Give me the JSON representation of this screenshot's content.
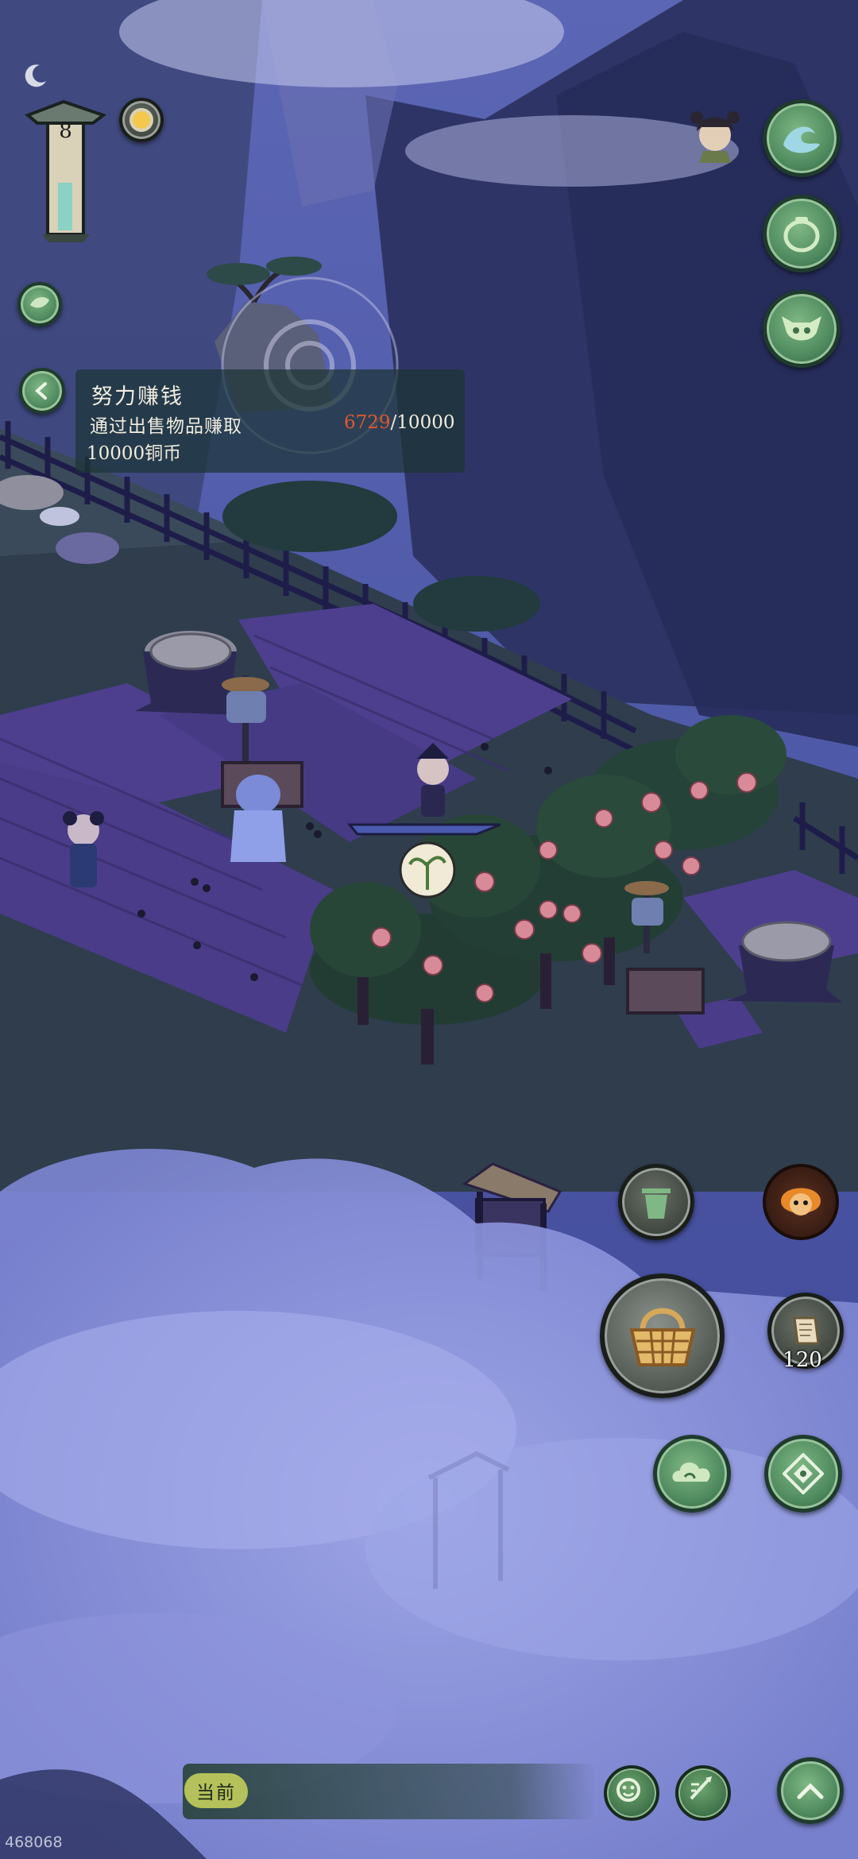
{
  "hud": {
    "level": "8",
    "moon_icon": "crescent-moon-icon",
    "sun_icon": "sun-orb-icon",
    "leaf_icon": "leaf-icon",
    "back_icon": "back-arrow-icon"
  },
  "task": {
    "title": "努力赚钱",
    "description_line1": "通过出售物品赚取",
    "description_line2": "10000铜币",
    "progress_current": "6729",
    "progress_separator": "/",
    "progress_total": "10000"
  },
  "right_menu": {
    "portrait_icon": "character-portrait-icon",
    "wave_icon": "wave-icon",
    "jar_icon": "jar-icon",
    "mask_icon": "demon-mask-icon"
  },
  "actions": {
    "trash_icon": "trash-can-icon",
    "monkey_icon": "fire-monkey-icon",
    "basket_icon": "basket-icon",
    "scroll_icon": "scroll-icon",
    "scroll_count": "120",
    "cloud_icon": "cloud-icon",
    "compass_icon": "compass-icon"
  },
  "bottom": {
    "current_label": "当前",
    "emote_icon": "emote-face-icon",
    "chat_icon": "chat-quill-icon",
    "expand_icon": "chevron-up-icon"
  },
  "watermark": "468068",
  "colors": {
    "sky": "#4b56a6",
    "mist": "#8f98dd",
    "field": "#4a3f86",
    "grass": "#2f3f4a",
    "button_green": "#4f8a5f",
    "progress_red": "#e0572e"
  }
}
